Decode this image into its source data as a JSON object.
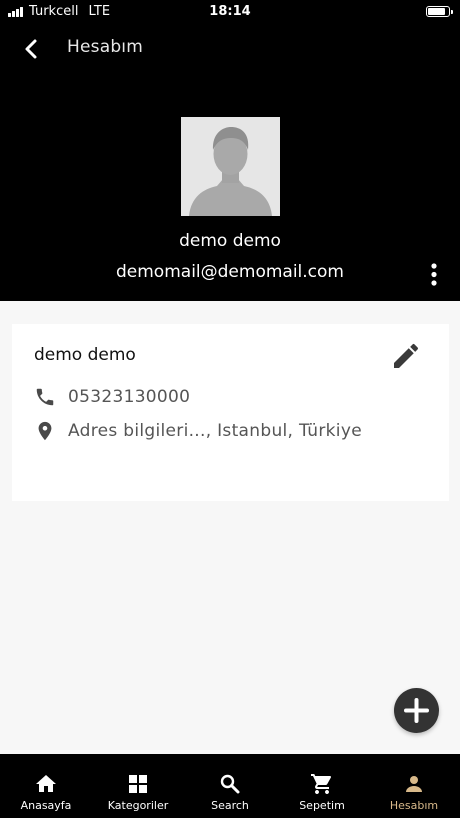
{
  "status_bar": {
    "carrier": "Turkcell",
    "network": "LTE",
    "time": "18:14",
    "battery_level": 0.85
  },
  "app_bar": {
    "back_icon": "chevron-left-icon",
    "title": "Hesabım"
  },
  "profile": {
    "avatar_icon": "person-silhouette-icon",
    "name": "demo demo",
    "email": "demomail@demomail.com",
    "more_icon": "more-vertical-icon"
  },
  "address_card": {
    "name": "demo demo",
    "edit_icon": "pencil-icon",
    "phone_icon": "phone-icon",
    "phone": "05323130000",
    "location_icon": "location-pin-icon",
    "address": "Adres bilgileri..., Istanbul, Türkiye"
  },
  "fab": {
    "icon": "plus-icon"
  },
  "bottom_nav": {
    "active_color": "#d8b98a",
    "items": [
      {
        "label": "Anasayfa",
        "icon": "home-icon"
      },
      {
        "label": "Kategoriler",
        "icon": "grid-icon"
      },
      {
        "label": "Search",
        "icon": "search-icon"
      },
      {
        "label": "Sepetim",
        "icon": "cart-icon"
      },
      {
        "label": "Hesabım",
        "icon": "person-icon",
        "active": true
      }
    ]
  }
}
